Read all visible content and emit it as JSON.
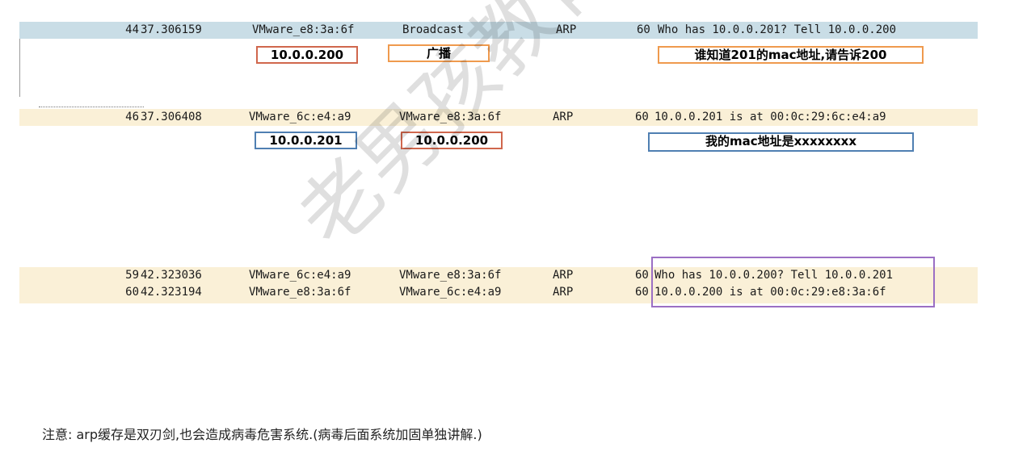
{
  "packets": [
    {
      "no": "44",
      "time": "37.306159",
      "source": "VMware_e8:3a:6f",
      "destination": "Broadcast",
      "protocol": "ARP",
      "length": "60",
      "info": "Who has 10.0.0.201? Tell 10.0.0.200"
    },
    {
      "no": "46",
      "time": "37.306408",
      "source": "VMware_6c:e4:a9",
      "destination": "VMware_e8:3a:6f",
      "protocol": "ARP",
      "length": "60",
      "info": "10.0.0.201 is at 00:0c:29:6c:e4:a9"
    },
    {
      "no": "59",
      "time": "42.323036",
      "source": "VMware_6c:e4:a9",
      "destination": "VMware_e8:3a:6f",
      "protocol": "ARP",
      "length": "60",
      "info": "Who has 10.0.0.200? Tell 10.0.0.201"
    },
    {
      "no": "60",
      "time": "42.323194",
      "source": "VMware_e8:3a:6f",
      "destination": "VMware_6c:e4:a9",
      "protocol": "ARP",
      "length": "60",
      "info": "10.0.0.200 is at 00:0c:29:e8:3a:6f"
    }
  ],
  "annotations": {
    "a1_source": "10.0.0.200",
    "a1_destination": "广播",
    "a1_info": "谁知道201的mac地址,请告诉200",
    "a2_source": "10.0.0.201",
    "a2_destination": "10.0.0.200",
    "a2_info": "我的mac地址是xxxxxxxx"
  },
  "note": "注意: arp缓存是双刃剑,也会造成病毒危害系统.(病毒后面系统加固单独讲解.)",
  "watermark": "老男孩教育-王牌讲师",
  "colors": {
    "selected_row": "#c9dde6",
    "arp_row": "#faf0d7",
    "box_red": "#d0674d",
    "box_orange": "#ef9a4e",
    "box_blue": "#4f7fb2",
    "box_purple": "#9b6fc4"
  }
}
